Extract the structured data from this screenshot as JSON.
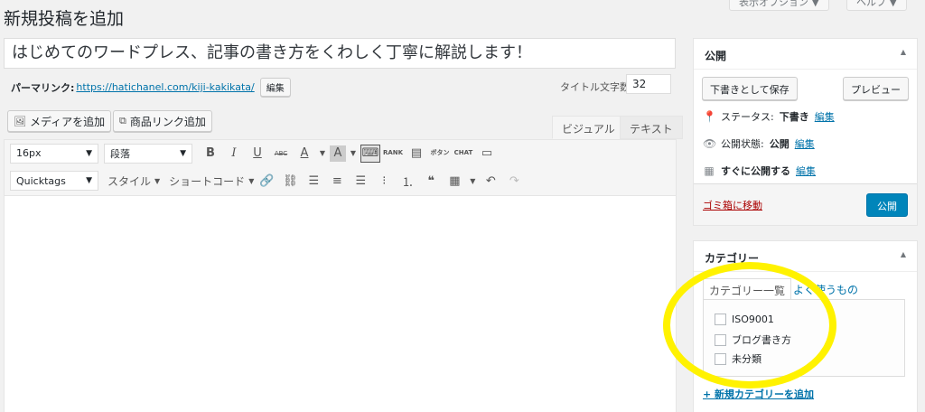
{
  "page": {
    "title": "新規投稿を追加"
  },
  "top_buttons": {
    "screen_options": "表示オプション ▼",
    "help": "ヘルプ ▼"
  },
  "post": {
    "title": "はじめてのワードプレス、記事の書き方をくわしく丁寧に解説します！",
    "permalink_label": "パーマリンク:",
    "permalink_url": "https://hatichanel.com/kiji-kakikata/",
    "edit_label": "編集",
    "title_count_label": "タイトル文字数:",
    "title_count_value": "32"
  },
  "media": {
    "add_media": "メディアを追加",
    "product_link": "商品リンク追加"
  },
  "editor_tabs": {
    "visual": "ビジュアル",
    "text": "テキスト"
  },
  "toolbar": {
    "font_size": "16px",
    "format": "段落",
    "quicktags": "Quicktags",
    "style": "スタイル",
    "shortcode": "ショートコード",
    "rank_label": "RANK",
    "button_label": "ボタン",
    "chat_label": "CHAT"
  },
  "publish_box": {
    "title": "公開",
    "save_draft": "下書きとして保存",
    "preview": "プレビュー",
    "status_label": "ステータス:",
    "status_value": "下書き",
    "visibility_label": "公開状態:",
    "visibility_value": "公開",
    "schedule_label": "すぐに公開する",
    "edit": "編集",
    "trash": "ゴミ箱に移動",
    "publish": "公開"
  },
  "category_box": {
    "title": "カテゴリー",
    "tab_all": "カテゴリー一覧",
    "tab_popular": "よく使うもの",
    "items": [
      "ISO9001",
      "ブログ書き方",
      "未分類"
    ],
    "add_new": "+ 新規カテゴリーを追加"
  },
  "colors": {
    "accent": "#0085ba",
    "link": "#0073aa",
    "highlight": "#fff200",
    "danger": "#a00"
  }
}
